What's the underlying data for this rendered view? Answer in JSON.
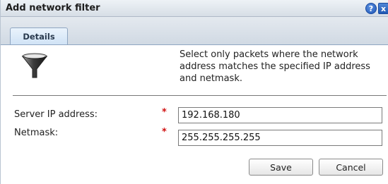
{
  "dialog": {
    "title": "Add network filter",
    "help_symbol": "?",
    "close_symbol": "x"
  },
  "tabs": [
    {
      "label": "Details"
    }
  ],
  "description": "Select only packets where the network address matches the specified IP address and netmask.",
  "form": {
    "server_ip": {
      "label": "Server IP address:",
      "required_mark": "*",
      "value": "192.168.180"
    },
    "netmask": {
      "label": "Netmask:",
      "required_mark": "*",
      "value": "255.255.255.255"
    }
  },
  "buttons": {
    "save": "Save",
    "cancel": "Cancel"
  },
  "colors": {
    "required": "#d01010",
    "title_buttons": "#1e55b8"
  },
  "icons": {
    "filter": "funnel-icon",
    "help": "help-icon",
    "close": "close-icon"
  }
}
